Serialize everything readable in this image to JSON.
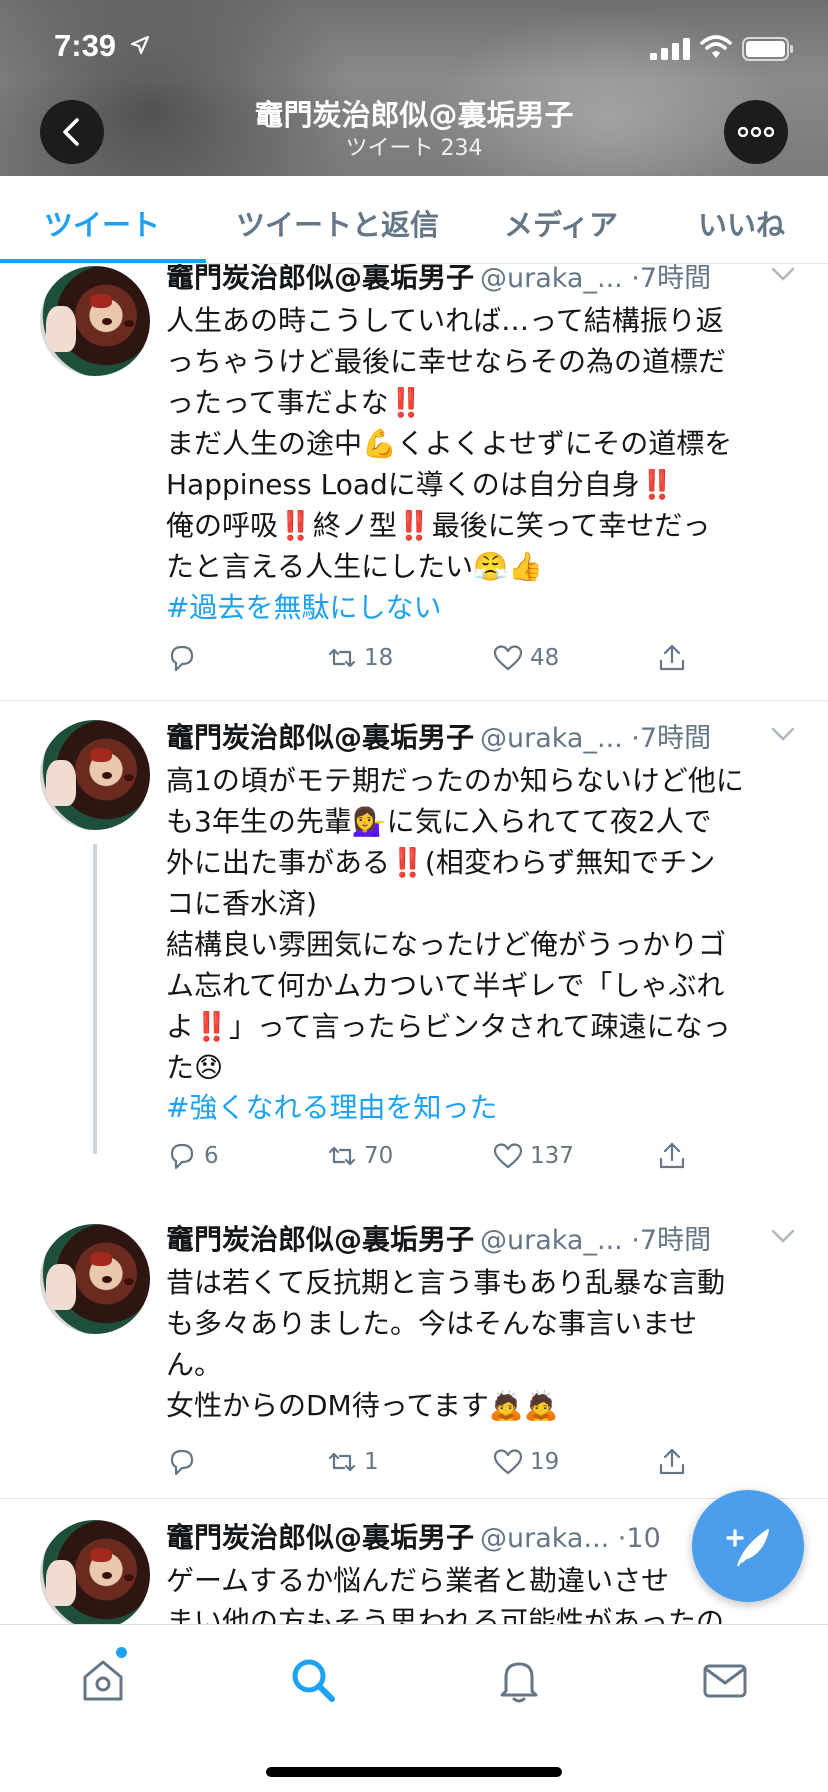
{
  "status_bar": {
    "time": "7:39"
  },
  "header": {
    "profile_name": "竈門炭治郎似@裏垢男子",
    "tweet_count": "ツイート 234"
  },
  "tabs": [
    {
      "label": "ツイート",
      "active": true
    },
    {
      "label": "ツイートと返信",
      "active": false
    },
    {
      "label": "メディア",
      "active": false
    },
    {
      "label": "いいね",
      "active": false
    }
  ],
  "tweets": [
    {
      "name": "竈門炭治郎似@裏垢男子",
      "handle": "@uraka_... ·7時間",
      "lines": [
        "人生あの時こうしていれば…って結構振り返",
        "っちゃうけど最後に幸せならその為の道標だ",
        "ったって事だよな‼️",
        "まだ人生の途中💪くよくよせずにその道標を",
        "Happiness Loadに導くのは自分自身‼️",
        "俺の呼吸‼️終ノ型‼️最後に笑って幸せだっ",
        "たと言える人生にしたい😤👍"
      ],
      "hashtag": "#過去を無駄にしない",
      "replies": "",
      "retweets": "18",
      "likes": "48"
    },
    {
      "name": "竈門炭治郎似@裏垢男子",
      "handle": "@uraka_... ·7時間",
      "lines": [
        "高1の頃がモテ期だったのか知らないけど他に",
        "も3年生の先輩💁‍♀️に気に入られてて夜2人で",
        "外に出た事がある‼️(相変わらず無知でチン",
        "コに香水済)",
        "結構良い雰囲気になったけど俺がうっかりゴ",
        "ム忘れて何かムカついて半ギレで「しゃぶれ",
        "よ‼️」って言ったらビンタされて疎遠になっ",
        "た😞"
      ],
      "hashtag": "#強くなれる理由を知った",
      "replies": "6",
      "retweets": "70",
      "likes": "137"
    },
    {
      "name": "竈門炭治郎似@裏垢男子",
      "handle": "@uraka_... ·7時間",
      "lines": [
        "昔は若くて反抗期と言う事もあり乱暴な言動",
        "も多々ありました。今はそんな事言いませ",
        "ん。",
        "女性からのDM待ってます🙇🙇"
      ],
      "hashtag": "",
      "replies": "",
      "retweets": "1",
      "likes": "19"
    },
    {
      "name": "竈門炭治郎似@裏垢男子",
      "handle": "@uraka... ·10",
      "lines": [
        "ゲームするか悩んだら業者と勘違いさせ",
        "まい他の方もそう思われる可能性があったの"
      ],
      "hashtag": "",
      "replies": "",
      "retweets": "",
      "likes": ""
    }
  ],
  "icons": {
    "back": "chevron-left-icon",
    "more": "more-dots-icon",
    "reply": "reply-icon",
    "retweet": "retweet-icon",
    "like": "heart-icon",
    "share": "share-icon",
    "compose": "compose-tweet-icon",
    "nav": [
      "home-icon",
      "search-icon",
      "bell-icon",
      "mail-icon"
    ]
  },
  "colors": {
    "accent": "#1da1f2",
    "muted": "#657786",
    "text": "#14171a"
  }
}
